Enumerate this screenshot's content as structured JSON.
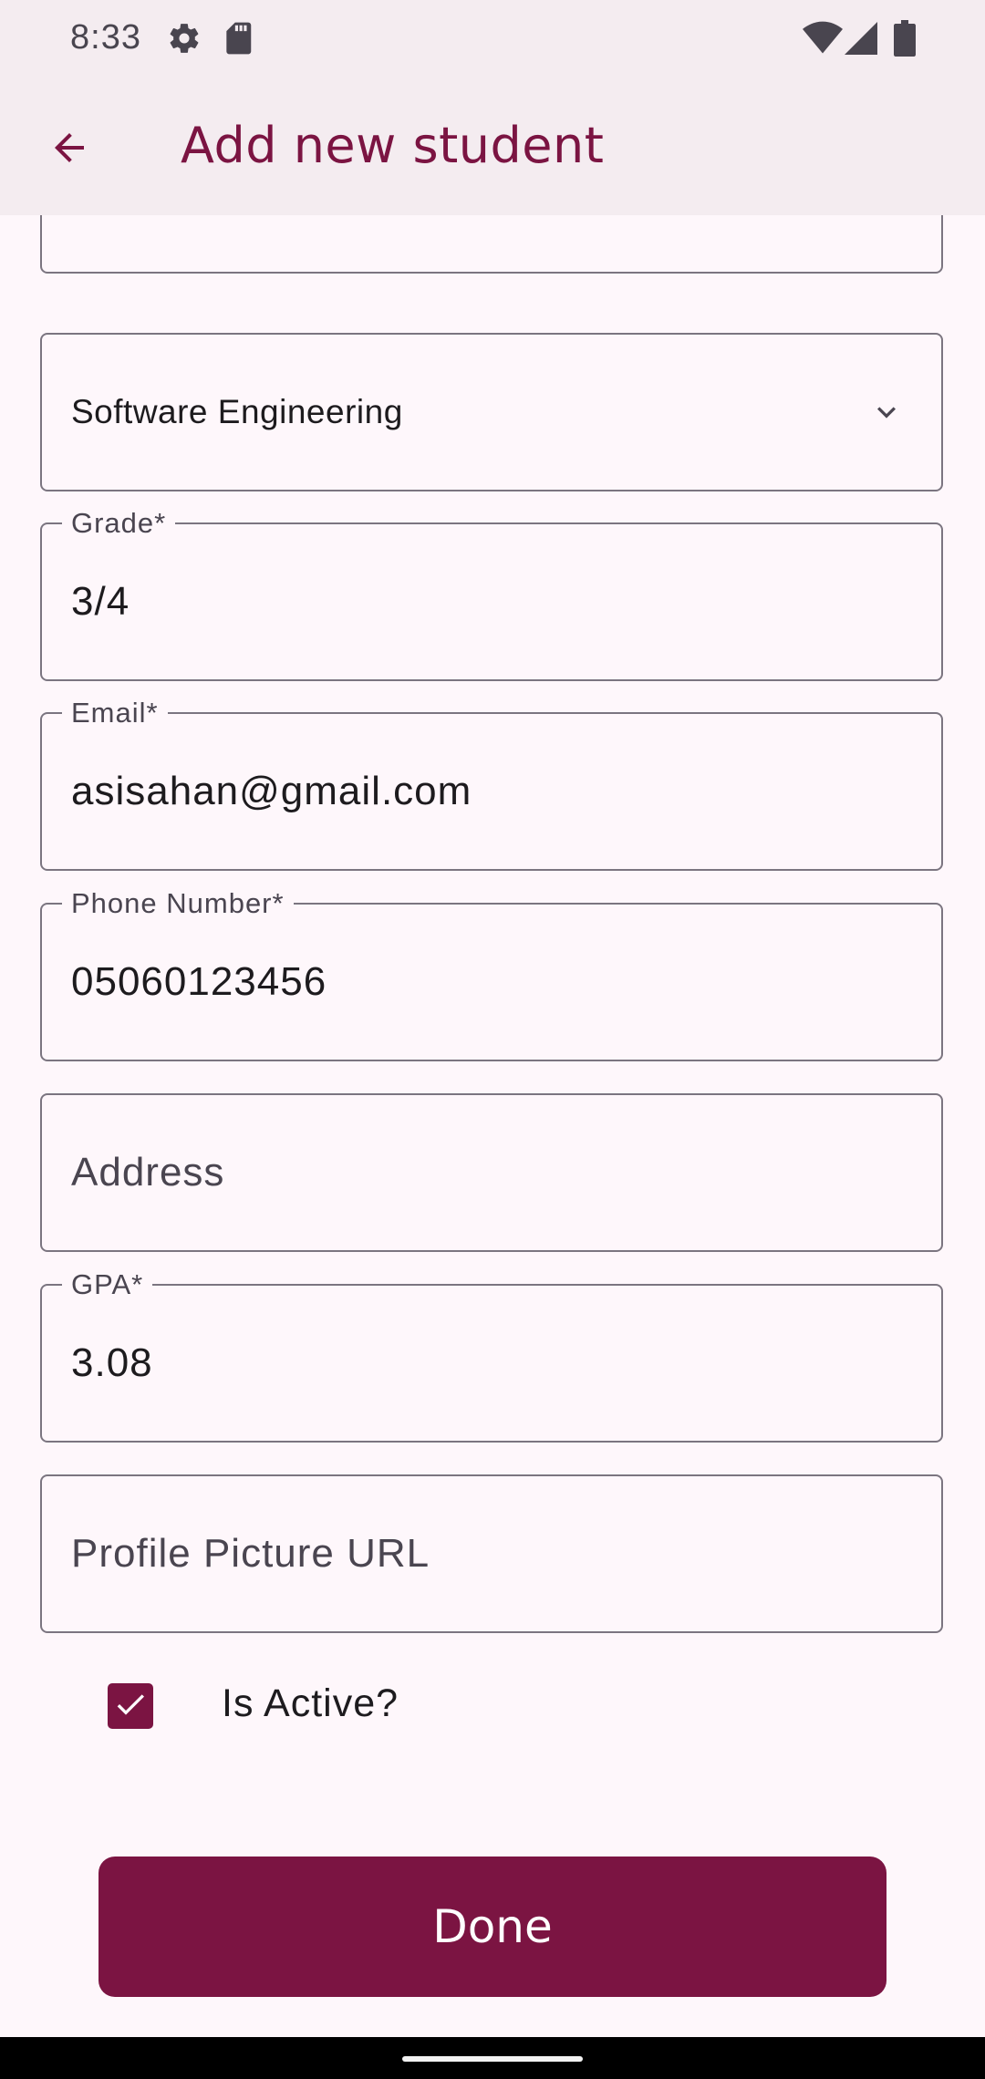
{
  "status_bar": {
    "time": "8:33",
    "icons": [
      "gear-icon",
      "sd-card-icon",
      "wifi-icon",
      "signal-icon",
      "battery-icon"
    ]
  },
  "app_bar": {
    "title": "Add new student",
    "back_icon": "arrow-back-icon"
  },
  "form": {
    "department": {
      "value": "Software Engineering",
      "icon": "chevron-down-icon"
    },
    "grade": {
      "label": "Grade*",
      "value": "3/4"
    },
    "email": {
      "label": "Email*",
      "value": "asisahan@gmail.com"
    },
    "phone": {
      "label": "Phone Number*",
      "value": "05060123456"
    },
    "address": {
      "placeholder": "Address"
    },
    "gpa": {
      "label": "GPA*",
      "value": "3.08"
    },
    "profile_picture": {
      "placeholder": "Profile Picture URL"
    },
    "is_active": {
      "label": "Is Active?",
      "checked": true
    }
  },
  "done_button": {
    "label": "Done"
  },
  "colors": {
    "primary": "#7b1442",
    "surface": "#fef7fb",
    "app_bar_bg": "#f4ecf0",
    "outline": "#7b7580"
  }
}
